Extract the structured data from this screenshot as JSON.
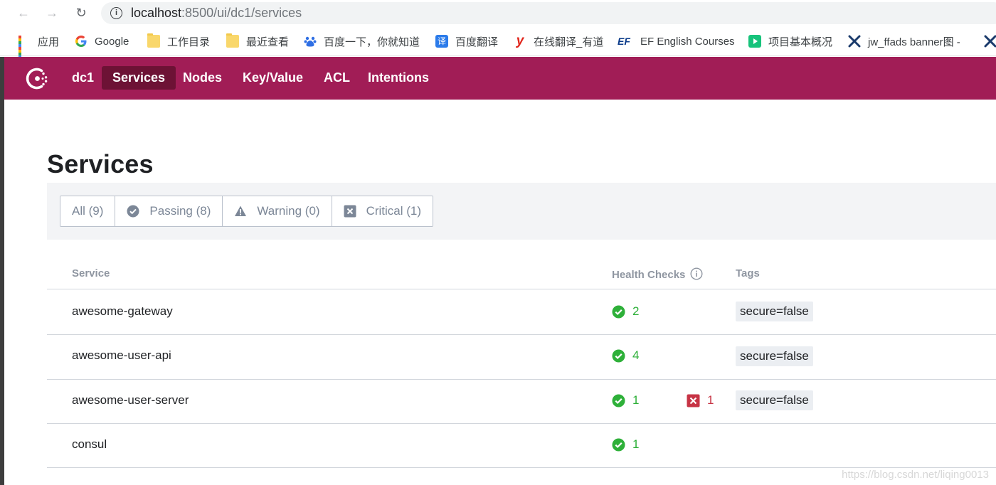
{
  "browser": {
    "url_host": "localhost",
    "url_path": ":8500/ui/dc1/services",
    "bookmarks": [
      {
        "label": "应用",
        "icon": "apps-grid-icon"
      },
      {
        "label": "Google",
        "icon": "google-g-icon"
      },
      {
        "label": "工作目录",
        "icon": "folder-icon"
      },
      {
        "label": "最近查看",
        "icon": "folder-icon"
      },
      {
        "label": "百度一下，你就知道",
        "icon": "baidu-paw-icon"
      },
      {
        "label": "百度翻译",
        "icon": "translate-icon"
      },
      {
        "label": "在线翻译_有道",
        "icon": "youdao-icon"
      },
      {
        "label": "EF English Courses",
        "icon": "ef-logo-icon"
      },
      {
        "label": "项目基本概况",
        "icon": "play-icon"
      },
      {
        "label": "jw_ffads banner图 -",
        "icon": "site-x-icon"
      }
    ],
    "bookmark_icon_texts": {
      "translate": "译",
      "youdao": "y",
      "ef": "EF"
    }
  },
  "nav": {
    "datacenter": "dc1",
    "items": [
      "Services",
      "Nodes",
      "Key/Value",
      "ACL",
      "Intentions"
    ],
    "active": "Services"
  },
  "page": {
    "title": "Services",
    "filters": [
      {
        "label": "All (9)",
        "icon": null,
        "active": true
      },
      {
        "label": "Passing (8)",
        "icon": "passing-check-icon",
        "active": false
      },
      {
        "label": "Warning (0)",
        "icon": "warning-triangle-icon",
        "active": false
      },
      {
        "label": "Critical (1)",
        "icon": "critical-x-icon",
        "active": false
      }
    ],
    "columns": {
      "service": "Service",
      "health": "Health Checks",
      "tags": "Tags"
    },
    "services": [
      {
        "name": "awesome-gateway",
        "passing": "2",
        "critical": null,
        "tag": "secure=false"
      },
      {
        "name": "awesome-user-api",
        "passing": "4",
        "critical": null,
        "tag": "secure=false"
      },
      {
        "name": "awesome-user-server",
        "passing": "1",
        "critical": "1",
        "tag": "secure=false"
      },
      {
        "name": "consul",
        "passing": "1",
        "critical": null,
        "tag": null
      }
    ]
  },
  "watermark": "https://blog.csdn.net/liqing0013",
  "colors": {
    "brand": "#a11d56",
    "brand_active": "#6d1235",
    "passing": "#2eb039",
    "critical": "#c73445"
  }
}
